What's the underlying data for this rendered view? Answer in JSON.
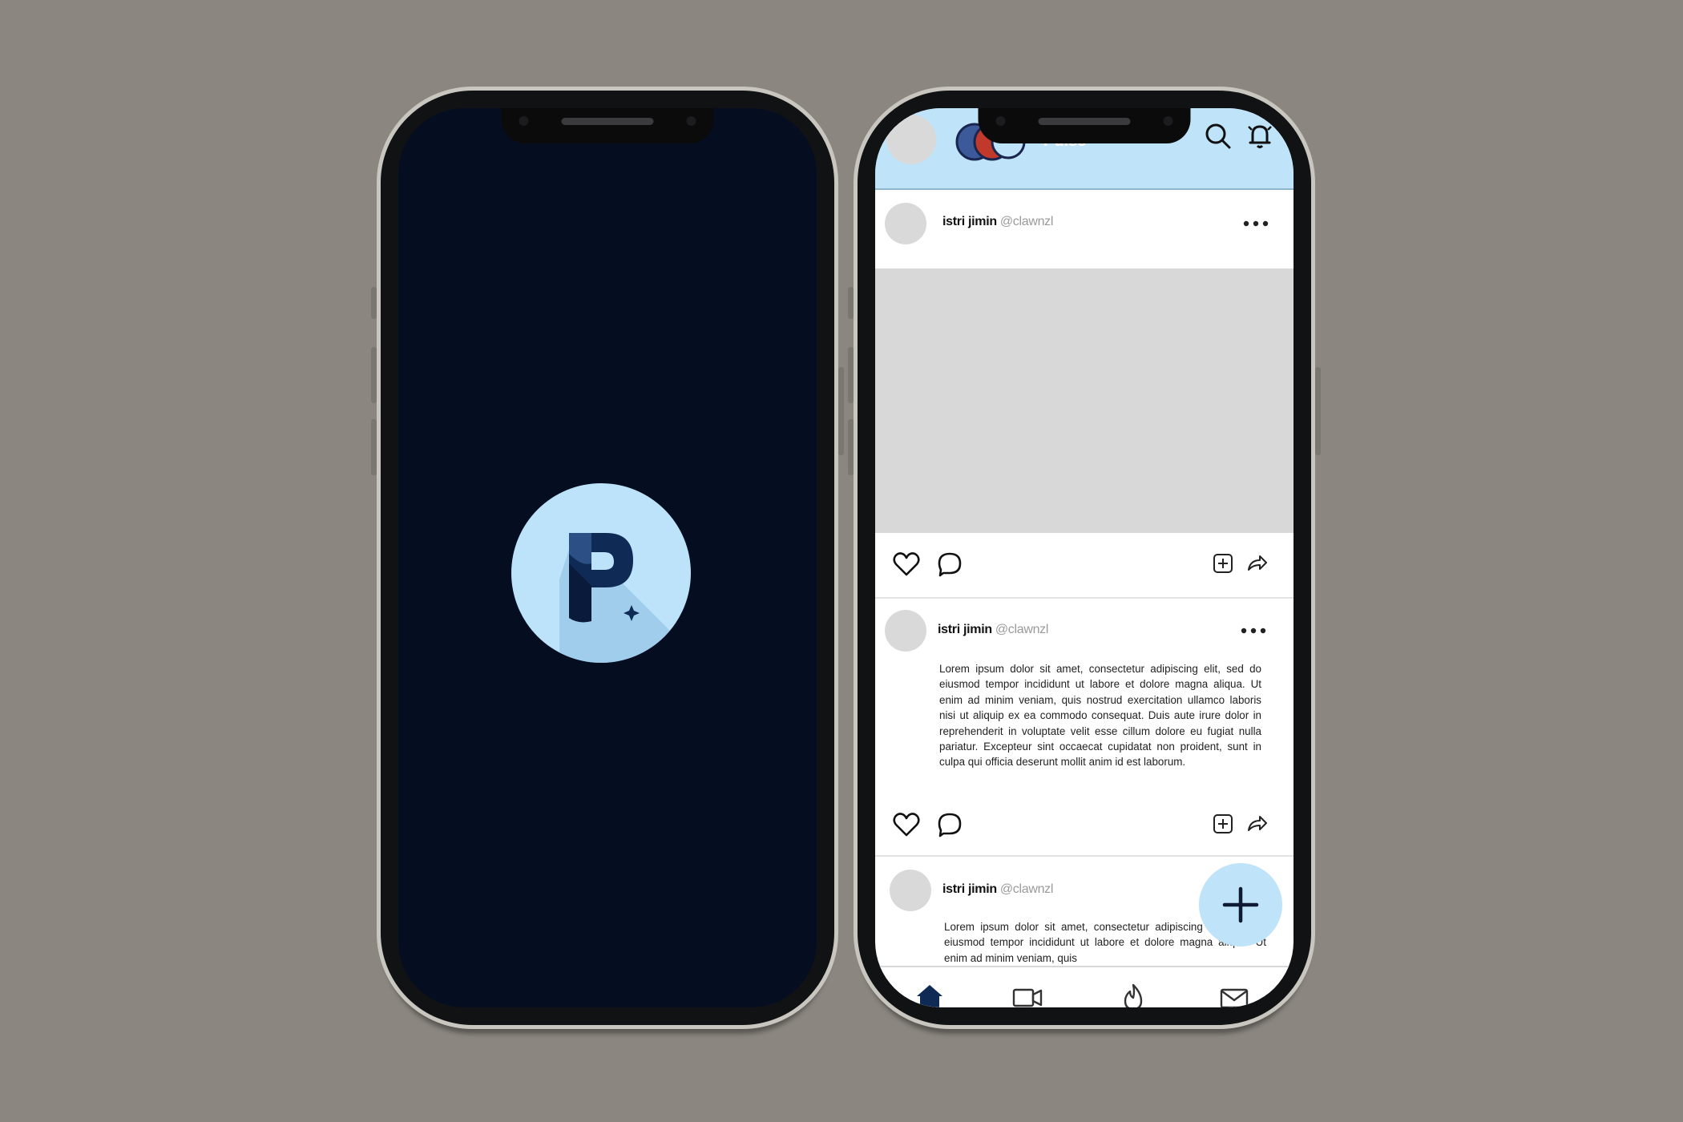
{
  "splash": {
    "logo_icon": "p-logo-icon",
    "colors": {
      "background": "#050e20",
      "logo_circle": "#bde3fb"
    }
  },
  "feed": {
    "header": {
      "app_name": "Pulse",
      "icons": [
        "profile-avatar",
        "app-logo-icon",
        "search-icon",
        "notification-bell-icon"
      ],
      "background": "#bfe3f9"
    },
    "posts": [
      {
        "name": "istri jimin",
        "handle": "@clawnzl",
        "type": "image",
        "actions": [
          "heart-icon",
          "comment-icon",
          "add-square-icon",
          "share-icon"
        ]
      },
      {
        "name": "istri jimin",
        "handle": "@clawnzl",
        "type": "text",
        "text": "Lorem ipsum dolor sit amet, consectetur adipiscing elit, sed do eiusmod tempor incididunt ut labore et dolore magna aliqua. Ut enim ad minim veniam, quis nostrud exercitation ullamco laboris nisi ut aliquip ex ea commodo consequat. Duis aute irure dolor in reprehenderit in voluptate velit esse cillum dolore eu fugiat nulla pariatur. Excepteur sint occaecat cupidatat non proident, sunt in culpa qui officia deserunt mollit anim id est laborum.",
        "actions": [
          "heart-icon",
          "comment-icon",
          "add-square-icon",
          "share-icon"
        ]
      },
      {
        "name": "istri jimin",
        "handle": "@clawnzl",
        "type": "text",
        "text": "Lorem ipsum dolor sit amet, consectetur adipiscing elit, sed do eiusmod tempor incididunt ut labore et dolore magna aliqua. Ut enim ad minim veniam, quis"
      }
    ],
    "fab_icon": "plus-icon",
    "bottom_nav": [
      "home-icon",
      "video-icon",
      "flame-icon",
      "mail-icon"
    ],
    "accent": "#bfe3f9"
  }
}
